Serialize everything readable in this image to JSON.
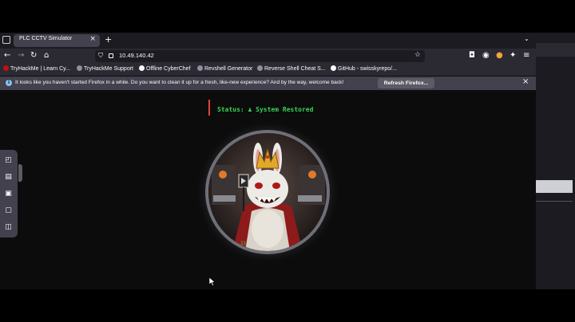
{
  "browser": {
    "tab_title": "PLC CCTV Simulator",
    "tab_close": "×",
    "new_tab": "+",
    "tab_overflow": "⌄",
    "url": "10.49.140.42",
    "bookmarks": [
      {
        "label": "TryHackMe | Learn Cy...",
        "icon_color": "#c11111"
      },
      {
        "label": "TryHackMe Support",
        "icon_color": "#8f8f9d"
      },
      {
        "label": "Offline CyberChef",
        "icon_color": "#fbfbfe"
      },
      {
        "label": "Revshell Generator",
        "icon_color": "#8f8f9d"
      },
      {
        "label": "Reverse Shell Cheat S...",
        "icon_color": "#8f8f9d"
      },
      {
        "label": "GitHub - swisskyrepo/...",
        "icon_color": "#fbfbfe"
      }
    ],
    "notification": {
      "text": "It looks like you haven't started Firefox in a while. Do you want to clean it up for a fresh, like-new experience? And by the way, welcome back!",
      "button": "Refresh Firefox...",
      "close": "×"
    }
  },
  "page": {
    "status": "Status: ♟ System Restored",
    "camera_timestamp": "11"
  },
  "colors": {
    "status_green": "#39d353",
    "status_accent": "#e0443a"
  }
}
